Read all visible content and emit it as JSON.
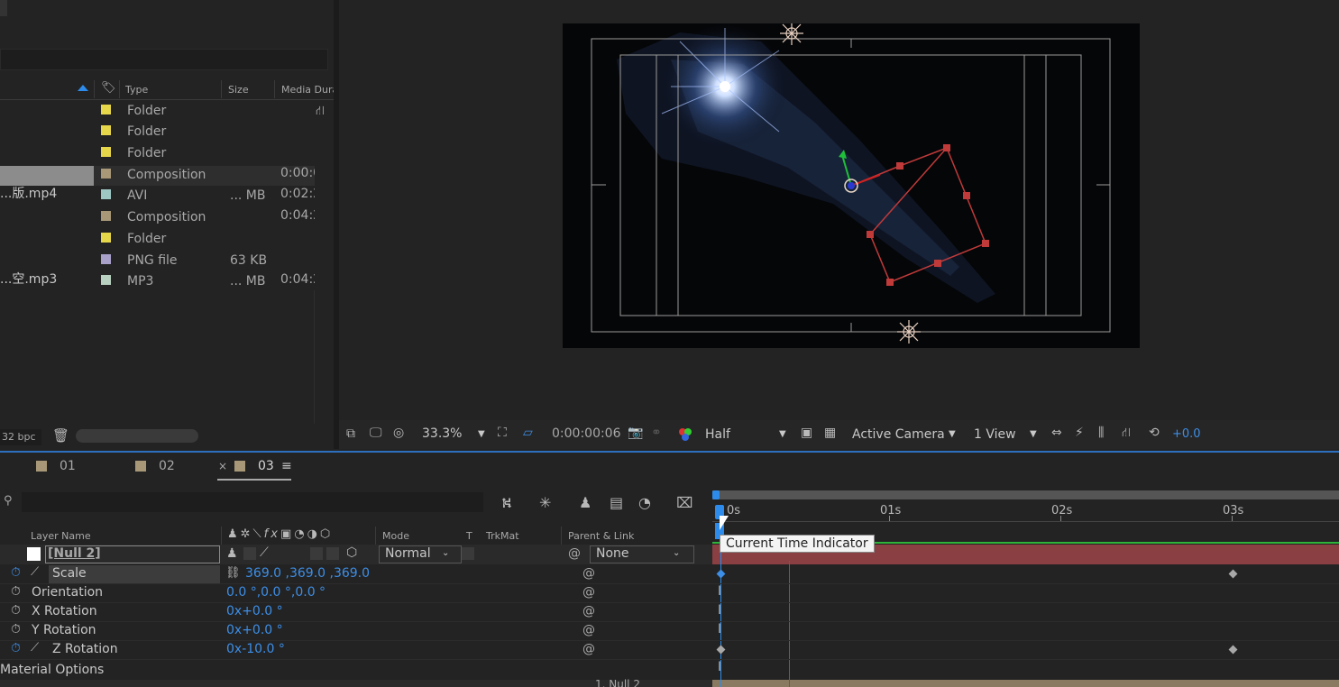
{
  "project": {
    "columns": {
      "type": "Type",
      "size": "Size",
      "media_duration": "Media Dura"
    },
    "rows": [
      {
        "name": "",
        "type": "Folder",
        "size": "",
        "duration": "",
        "color": "#e6d64a"
      },
      {
        "name": "",
        "type": "Folder",
        "size": "",
        "duration": "",
        "color": "#e6d64a"
      },
      {
        "name": "",
        "type": "Folder",
        "size": "",
        "duration": "",
        "color": "#e6d64a"
      },
      {
        "name": "",
        "type": "Composition",
        "size": "",
        "duration": "0:00:0",
        "color": "#a89878"
      },
      {
        "name": "...版.mp4",
        "type": "AVI",
        "size": "... MB",
        "duration": "0:02:2",
        "color": "#9ec7c4"
      },
      {
        "name": "",
        "type": "Composition",
        "size": "",
        "duration": "0:04:2",
        "color": "#a89878"
      },
      {
        "name": "",
        "type": "Folder",
        "size": "",
        "duration": "",
        "color": "#e6d64a"
      },
      {
        "name": "",
        "type": "PNG file",
        "size": "63 KB",
        "duration": "",
        "color": "#a8a0c8"
      },
      {
        "name": "...空.mp3",
        "type": "MP3",
        "size": "... MB",
        "duration": "0:04:2",
        "color": "#b8d0c0"
      }
    ],
    "bpc": "32 bpc"
  },
  "viewer": {
    "zoom": "33.3%",
    "timecode": "0:00:00:06",
    "resolution": "Half",
    "camera": "Active Camera",
    "views": "1 View",
    "exposure": "+0.0"
  },
  "timeline": {
    "tabs": [
      "01",
      "02",
      "03"
    ],
    "columns": {
      "layer_name": "Layer Name",
      "mode": "Mode",
      "t": "T",
      "trkmat": "TrkMat",
      "parent": "Parent & Link"
    },
    "ruler": [
      "0s",
      "01s",
      "02s",
      "03s"
    ],
    "tooltip": "Current Time Indicator",
    "layer": {
      "name": "[Null 2]",
      "mode": "Normal",
      "parent": "None"
    },
    "properties": [
      {
        "name": "Scale",
        "value": "369.0 ,369.0 ,369.0"
      },
      {
        "name": "Orientation",
        "value": "0.0 °,0.0 °,0.0 °"
      },
      {
        "name": "X Rotation",
        "value": "0x+0.0 °"
      },
      {
        "name": "Y Rotation",
        "value": "0x+0.0 °"
      },
      {
        "name": "Z Rotation",
        "value": "0x-10.0 °"
      }
    ],
    "material_options": "Material Options",
    "next_layer_parent": "1. Null 2"
  }
}
